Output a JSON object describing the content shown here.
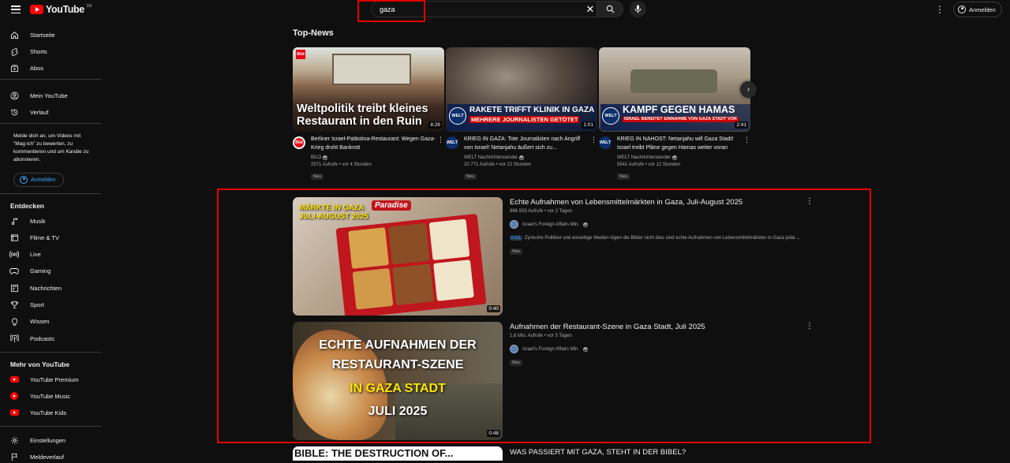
{
  "header": {
    "logo_text": "YouTube",
    "logo_region": "DE",
    "search_value": "gaza",
    "signin_label": "Anmelden",
    "accent_red": "#ff0000",
    "link_blue": "#3ea6ff"
  },
  "sidebar": {
    "main": [
      {
        "label": "Startseite",
        "icon": "home-icon"
      },
      {
        "label": "Shorts",
        "icon": "shorts-icon"
      },
      {
        "label": "Abos",
        "icon": "subscriptions-icon"
      }
    ],
    "you": [
      {
        "label": "Mein YouTube",
        "icon": "account-icon"
      },
      {
        "label": "Verlauf",
        "icon": "history-icon"
      }
    ],
    "signin_prompt": "Melde dich an, um Videos mit \"Mag ich\" zu bewerten, zu kommentieren und um Kanäle zu abonnieren.",
    "signin_label": "Anmelden",
    "explore_heading": "Entdecken",
    "explore": [
      {
        "label": "Musik",
        "icon": "music-icon"
      },
      {
        "label": "Filme & TV",
        "icon": "film-icon"
      },
      {
        "label": "Live",
        "icon": "live-icon"
      },
      {
        "label": "Gaming",
        "icon": "gaming-icon"
      },
      {
        "label": "Nachrichten",
        "icon": "news-icon"
      },
      {
        "label": "Sport",
        "icon": "trophy-icon"
      },
      {
        "label": "Wissen",
        "icon": "lightbulb-icon"
      },
      {
        "label": "Podcasts",
        "icon": "podcast-icon"
      }
    ],
    "more_heading": "Mehr von YouTube",
    "more": [
      {
        "label": "YouTube Premium",
        "icon": "youtube-premium-icon"
      },
      {
        "label": "YouTube Music",
        "icon": "youtube-music-icon"
      },
      {
        "label": "YouTube Kids",
        "icon": "youtube-kids-icon"
      }
    ],
    "settings": [
      {
        "label": "Einstellungen",
        "icon": "gear-icon"
      },
      {
        "label": "Meldeverlauf",
        "icon": "flag-icon"
      }
    ]
  },
  "top_news": {
    "heading": "Top-News",
    "cards": [
      {
        "thumb_caption": "Weltpolitik treibt kleines Restaurant in den Ruin",
        "duration": "8:26",
        "channel_badge": "Bild",
        "title": "Berliner Israel-Palästina-Restaurant: Wegen Gaza-Krieg droht Bankrott",
        "channel": "BILD",
        "views": "2571 Aufrufe • vor 4 Stunden",
        "badge": "Neu"
      },
      {
        "thumb_caption": "RAKETE TRIFFT KLINIK IN GAZA",
        "thumb_subcaption": "MEHRERE JOURNALISTEN GETÖTET",
        "duration": "1:01",
        "channel_badge": "WELT",
        "title": "KRIEG IN GAZA: Tote Journalisten nach Angriff von Israel! Netanjahu äußert sich zu...",
        "channel": "WELT Nachrichtensender",
        "views": "20.771 Aufrufe • vor 22 Stunden",
        "badge": "Neu"
      },
      {
        "thumb_caption": "KAMPF GEGEN HAMAS",
        "thumb_subcaption": "ISRAEL BEREITET EINNAHME VON GAZA STADT VOR",
        "duration": "2:41",
        "channel_badge": "WELT",
        "title": "KRIEG IN NAHOST: Netanjahu will Gaza Stadt! Israel treibt Pläne gegen Hamas weiter voran",
        "channel": "WELT Nachrichtensender",
        "views": "5541 Aufrufe • vor 12 Stunden",
        "badge": "Neu"
      }
    ]
  },
  "results": [
    {
      "thumb_caption": "MÄRKTE IN GAZA\nJULI-AUGUST 2025",
      "thumb_brand": "Paradise",
      "duration": "0:40",
      "title": "Echte Aufnahmen von Lebensmittelmärkten in Gaza, Juli-August 2025",
      "views": "966.933 Aufrufe • vor 2 Tagen",
      "channel": "Israel's Foreign Affairs Min.",
      "snippet_ts": "0:01",
      "snippet": "Zynische Politiker und einseitige Medien lügen die Bilder nicht dies sind echte Aufnahmen von Lebensmittelmärkten in Gaza juliai ...",
      "badge": "Neu"
    },
    {
      "thumb_line1": "ECHTE AUFNAHMEN DER",
      "thumb_line2": "RESTAURANT-SZENE",
      "thumb_line3": "IN GAZA STADT",
      "thumb_line4": "JULI 2025",
      "duration": "0:48",
      "title": "Aufnahmen der Restaurant-Szene in Gaza Stadt, Juli 2025",
      "views": "1,6 Mio. Aufrufe • vor 5 Tagen",
      "channel": "Israel's Foreign Affairs Min.",
      "badge": "Neu"
    },
    {
      "thumb_caption": "BIBLE: THE DESTRUCTION OF...",
      "title": "WAS PASSIERT MIT GAZA, STEHT IN DER BIBEL?"
    }
  ]
}
